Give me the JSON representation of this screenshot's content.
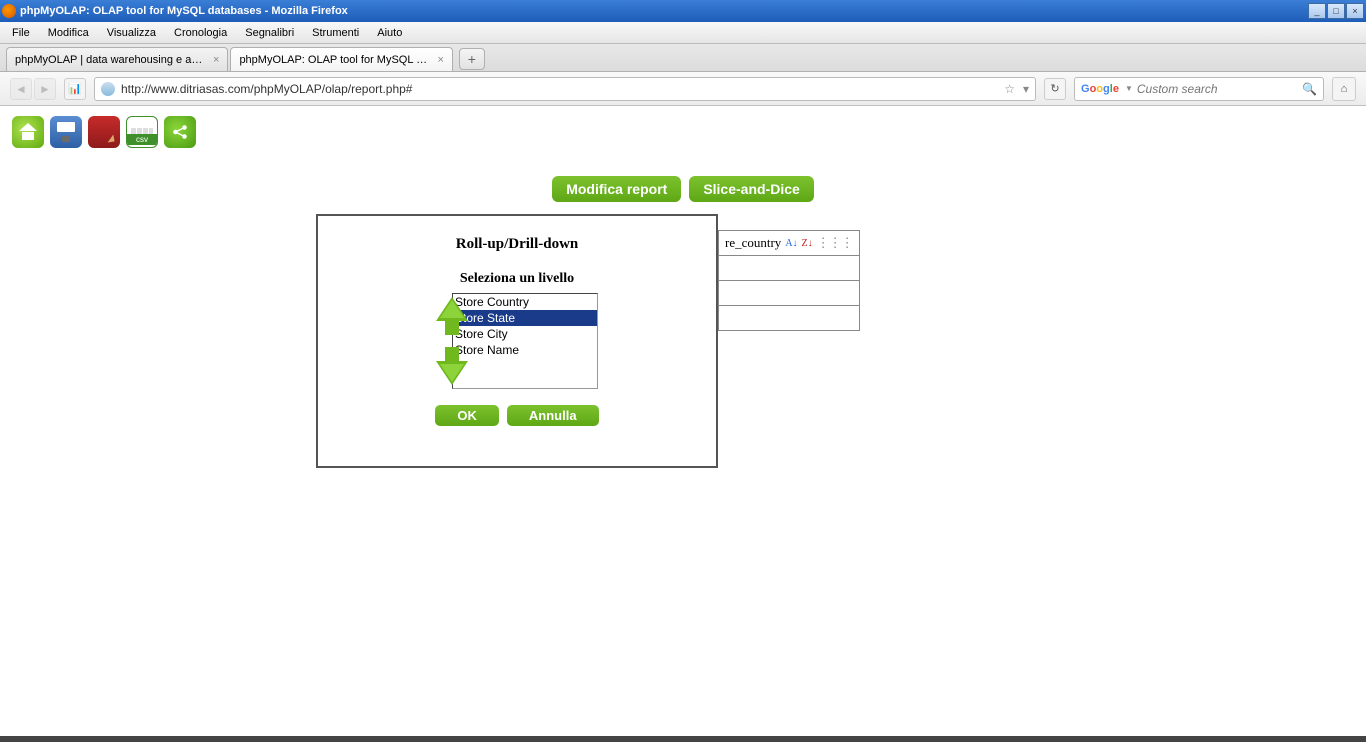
{
  "window": {
    "title": "phpMyOLAP: OLAP tool for MySQL databases - Mozilla Firefox"
  },
  "menu": [
    "File",
    "Modifica",
    "Visualizza",
    "Cronologia",
    "Segnalibri",
    "Strumenti",
    "Aiuto"
  ],
  "tabs": [
    {
      "label": "phpMyOLAP | data warehousing e analisi ...",
      "active": false
    },
    {
      "label": "phpMyOLAP: OLAP tool for MySQL datab...",
      "active": true
    }
  ],
  "url": "http://www.ditriasas.com/phpMyOLAP/olap/report.php#",
  "search": {
    "placeholder": "Custom search"
  },
  "toolbar": {
    "csv_label": "csv"
  },
  "actions": {
    "modify": "Modifica report",
    "slice": "Slice-and-Dice"
  },
  "bg_table": {
    "header": "re_country"
  },
  "dialog": {
    "title": "Roll-up/Drill-down",
    "subtitle": "Seleziona un livello",
    "options": [
      "Store Country",
      "Store State",
      "Store City",
      "Store Name"
    ],
    "selected_index": 1,
    "ok": "OK",
    "cancel": "Annulla"
  }
}
